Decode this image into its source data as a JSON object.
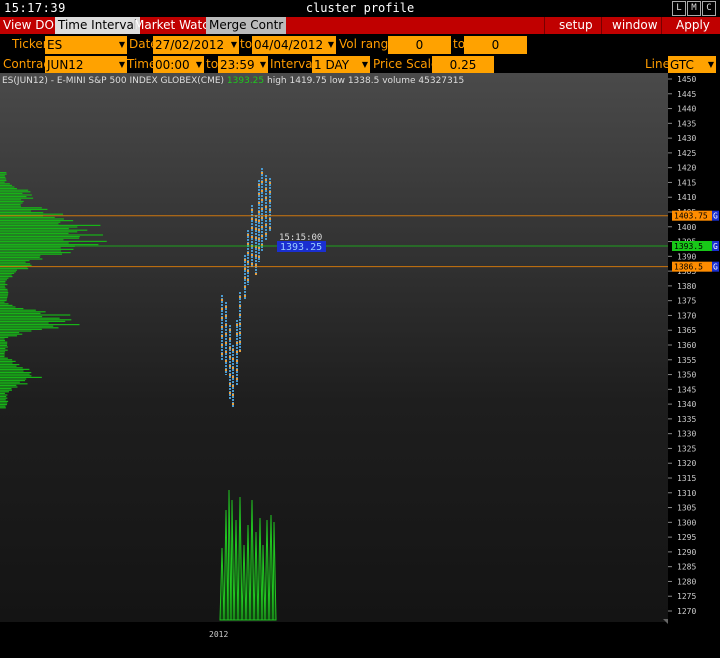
{
  "window": {
    "clock": "15:17:39",
    "title": "cluster profile",
    "controls": [
      "L",
      "M",
      "C"
    ]
  },
  "menubar": {
    "view_dom": "View DOM",
    "time_interval": "Time Interval",
    "market_watch": "Market Watch",
    "merge_contr": "Merge Contr",
    "setup": "setup",
    "window": "window",
    "apply": "Apply"
  },
  "filters": {
    "ticker_label": "Ticker",
    "ticker_value": "ES",
    "date_label": "Date",
    "date_from": "27/02/2012",
    "to_label": "to",
    "date_to": "04/04/2012",
    "vol_range_label": "Vol range",
    "vol_from": "0",
    "vol_to_label": "to",
    "vol_to": "0",
    "contract_label": "Contract",
    "contract_value": "JUN12",
    "time_label": "Time",
    "time_from": "00:00",
    "time_to_label": "to",
    "time_to": "23:59",
    "interval_label": "Interval",
    "interval_value": "1 DAY",
    "price_scale_label": "Price Scale",
    "price_scale_value": "0.25",
    "line_label": "Line",
    "line_value": "GTC"
  },
  "chart_info": {
    "instrument": "ES(JUN12) - E-MINI S&P 500 INDEX GLOBEX(CME)",
    "last": "1393.25",
    "high_text": "high 1419.75",
    "low_text": "low 1338.5",
    "volume_text": "volume 45327315"
  },
  "cursor": {
    "time": "15:15:00",
    "price": "1393.25"
  },
  "price_axis": {
    "ticks": [
      1450,
      1445,
      1440,
      1435,
      1430,
      1425,
      1420,
      1415,
      1410,
      1405,
      1400,
      1395,
      1390,
      1385,
      1380,
      1375,
      1370,
      1365,
      1360,
      1355,
      1350,
      1345,
      1340,
      1335,
      1330,
      1325,
      1320,
      1315,
      1310,
      1305,
      1300,
      1295,
      1290,
      1285,
      1280,
      1275,
      1270
    ],
    "markers": [
      {
        "label": "1403.75",
        "suffix": "G",
        "color": "#ff8c00",
        "price": 1403.75
      },
      {
        "label": "1393.5",
        "suffix": "G",
        "color": "#18c818",
        "price": 1393.5
      },
      {
        "label": "1386.5",
        "suffix": "G",
        "color": "#ff8c00",
        "price": 1386.5
      }
    ]
  },
  "x_axis": {
    "label": "2012"
  },
  "colors": {
    "menubar": "#c00000",
    "field": "#ffa200",
    "label": "#ff9c00",
    "profile": "#17b417",
    "line_orange": "#c87820",
    "line_green": "#18c818"
  }
}
